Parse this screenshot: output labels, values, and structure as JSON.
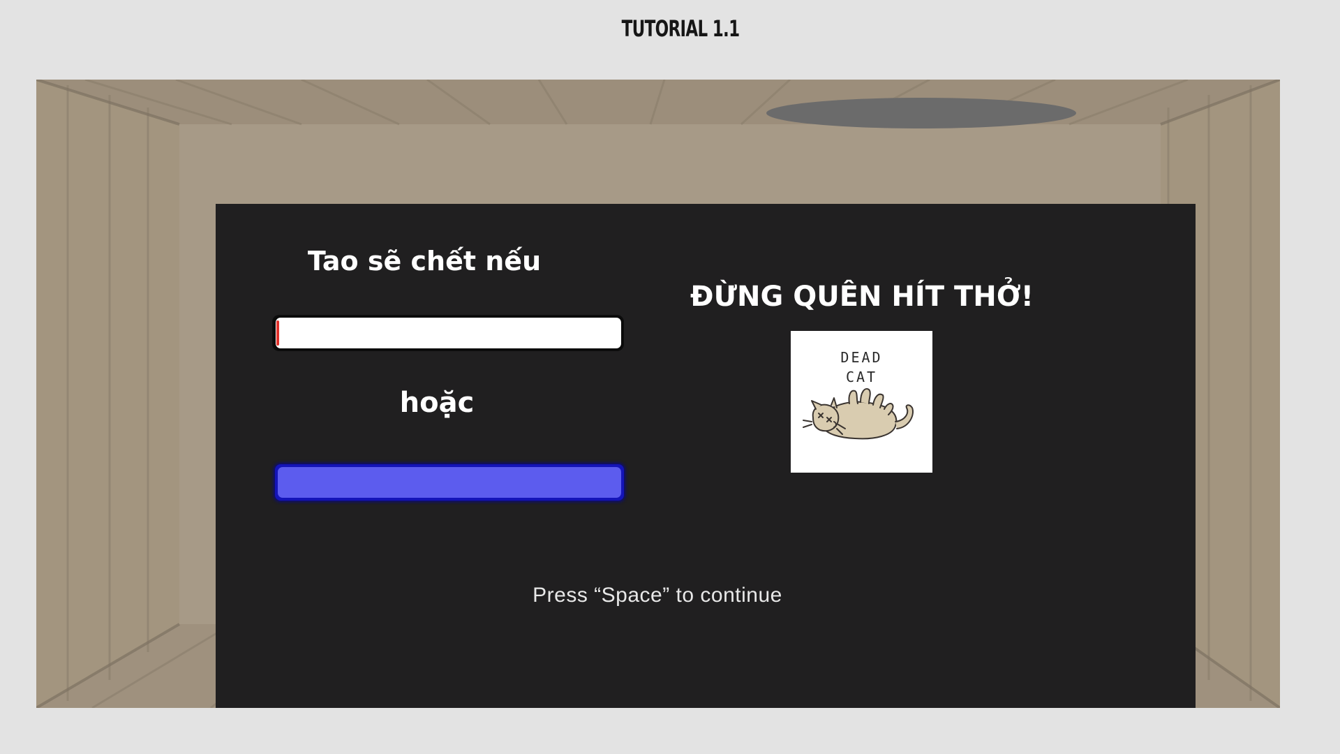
{
  "header": {
    "title": "TUTORIAL 1.1"
  },
  "colors": {
    "page_background": "#e3e3e3",
    "panel_background": "#201f20",
    "floor_wood": "#a89a86",
    "breath_bar_fill": "#ffffff",
    "breath_bar_marker": "#e0312b",
    "stamina_bar_fill": "#5c5cee",
    "stamina_bar_border": "#1414b8",
    "text": "#ffffff"
  },
  "tutorial": {
    "warning_text": "Tao sẽ chết nếu",
    "or_text": "hoặc",
    "breathe_reminder": "ĐỪNG QUÊN HÍT THỞ!",
    "continue_hint": "Press “Space” to continue"
  },
  "bars": {
    "breath_bar": {
      "fill_fraction": 1.0,
      "marker_fraction": 0.01
    },
    "stamina_bar": {
      "fill_fraction": 1.0
    }
  },
  "illustration": {
    "caption": "DEAD\nCAT",
    "icon": "dead-cat-icon"
  }
}
